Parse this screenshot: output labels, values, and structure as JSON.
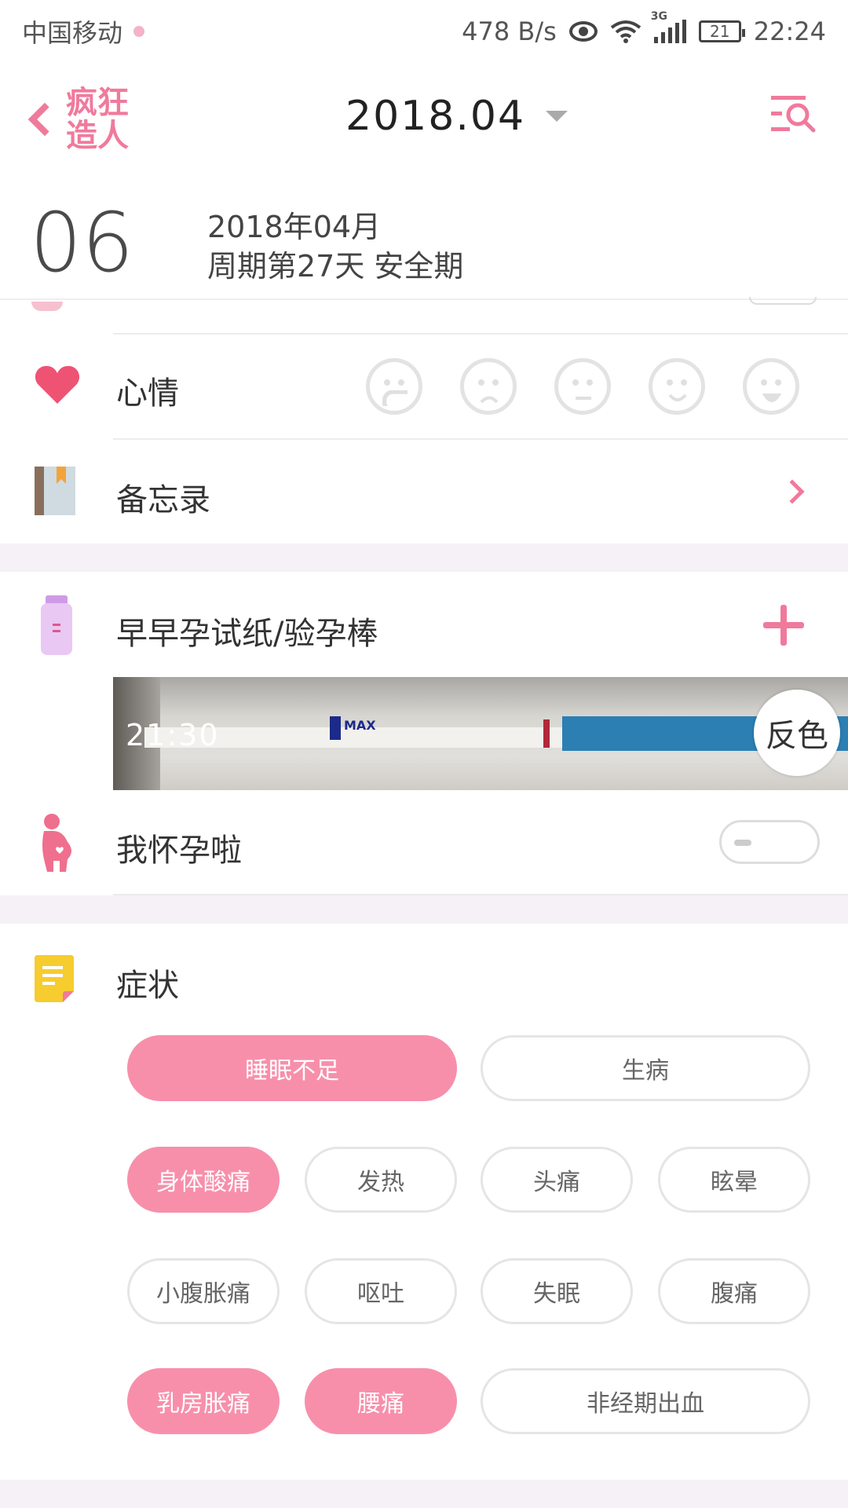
{
  "status_bar": {
    "carrier": "中国移动",
    "net_speed": "478 B/s",
    "network_type": "3G",
    "battery": "21",
    "time": "22:24"
  },
  "header": {
    "logo_line1": "疯狂",
    "logo_line2": "造人",
    "month": "2018.04"
  },
  "date_info": {
    "day": "06",
    "year_month": "2018年04月",
    "cycle": "周期第27天  安全期"
  },
  "mood": {
    "label": "心情",
    "options": [
      "crying-face-icon",
      "sad-face-icon",
      "neutral-face-icon",
      "smile-face-icon",
      "happy-face-icon"
    ]
  },
  "memo": {
    "label": "备忘录"
  },
  "pregnancy_test": {
    "label": "早早孕试纸/验孕棒",
    "photo_time": "21:30",
    "invert_label": "反色",
    "strip_text": "MAX"
  },
  "pregnant": {
    "label": "我怀孕啦",
    "on": false
  },
  "symptoms": {
    "label": "症状",
    "tags": [
      {
        "label": "睡眠不足",
        "selected": true
      },
      {
        "label": "生病",
        "selected": false
      },
      {
        "label": "身体酸痛",
        "selected": true
      },
      {
        "label": "发热",
        "selected": false
      },
      {
        "label": "头痛",
        "selected": false
      },
      {
        "label": "眩晕",
        "selected": false
      },
      {
        "label": "小腹胀痛",
        "selected": false
      },
      {
        "label": "呕吐",
        "selected": false
      },
      {
        "label": "失眠",
        "selected": false
      },
      {
        "label": "腹痛",
        "selected": false
      },
      {
        "label": "乳房胀痛",
        "selected": true
      },
      {
        "label": "腰痛",
        "selected": true
      },
      {
        "label": "非经期出血",
        "selected": false
      }
    ]
  },
  "colors": {
    "accent": "#f07a9c",
    "tag_selected": "#f78fab",
    "section_gap": "#f5f1f6"
  }
}
